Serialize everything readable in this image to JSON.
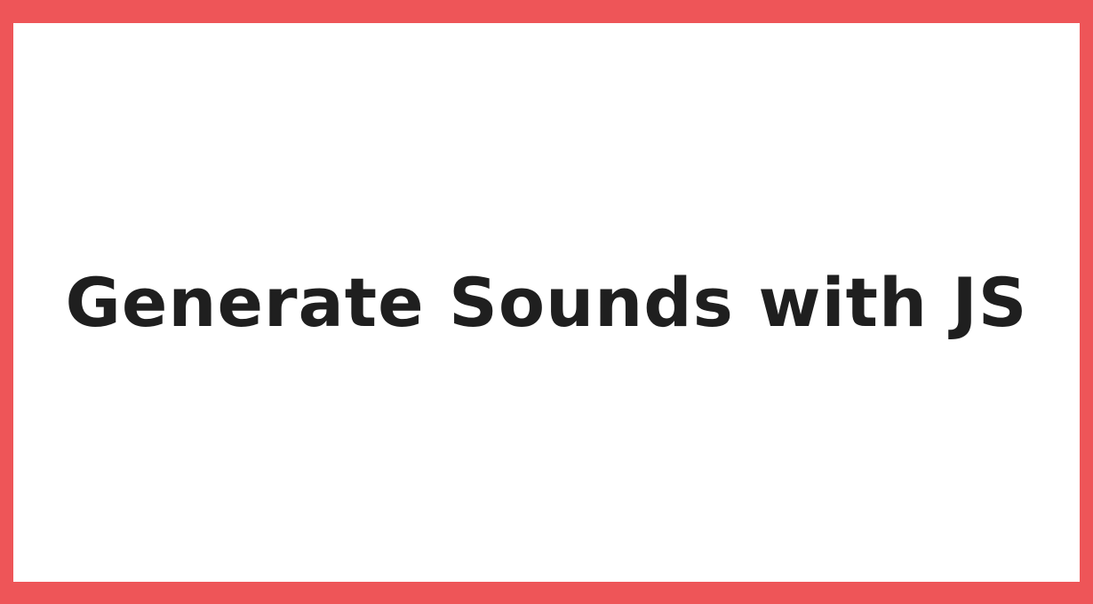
{
  "banner": {
    "title": "Generate Sounds with JS",
    "border_color": "#ee5558",
    "background_color": "#ffffff",
    "text_color": "#1f1f1f"
  }
}
